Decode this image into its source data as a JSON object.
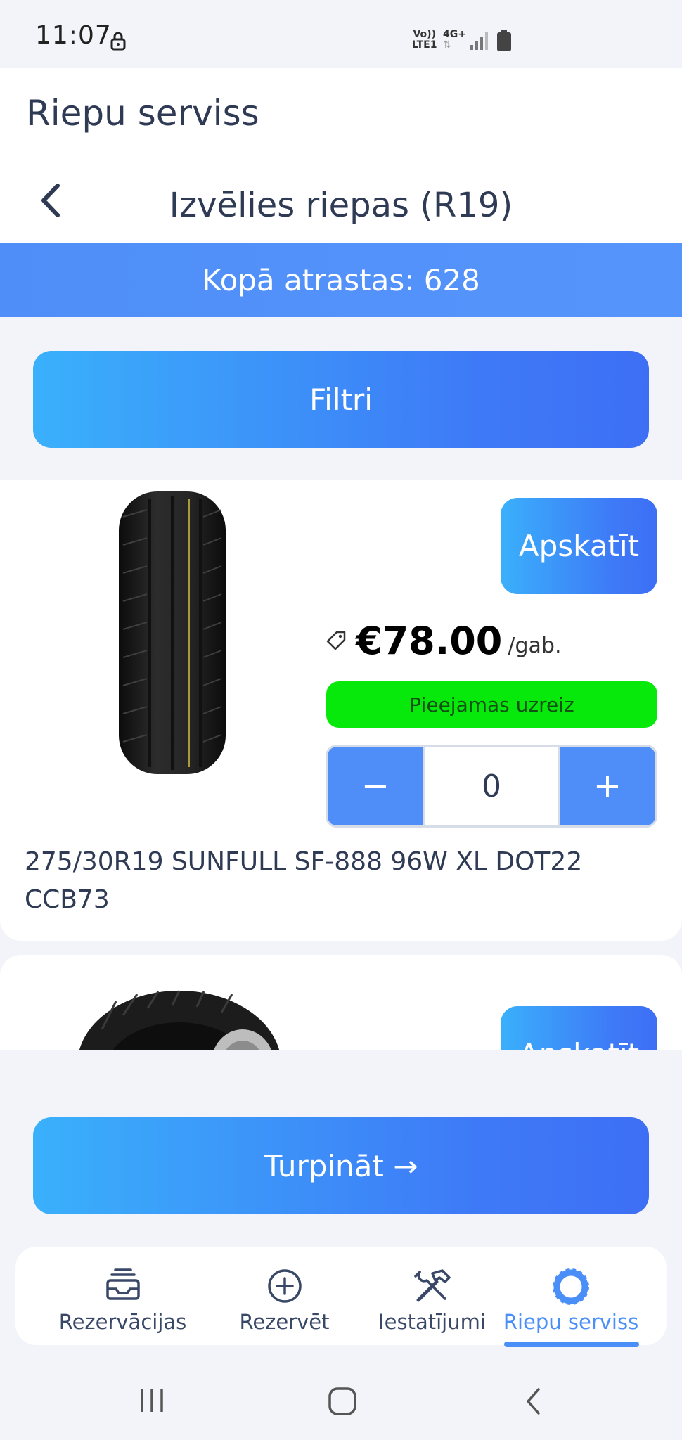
{
  "status_bar": {
    "time": "11:07",
    "network_top": "Vo))",
    "network_bottom": "LTE1",
    "network_type": "4G+"
  },
  "header": {
    "app_title": "Riepu serviss",
    "page_title": "Izvēlies riepas (R19)"
  },
  "results": {
    "count_label": "Kopā atrastas: 628"
  },
  "filters": {
    "label": "Filtri"
  },
  "products": [
    {
      "view_label": "Apskatīt",
      "price": "€78.00",
      "unit": "/gab.",
      "availability": "Pieejamas uzreiz",
      "availability_color": "#07e80b",
      "quantity": "0",
      "name": "275/30R19 SUNFULL SF-888 96W XL DOT22 CCB73"
    },
    {
      "view_label": "Apskatīt"
    }
  ],
  "stepper": {
    "minus": "−",
    "plus": "+"
  },
  "actions": {
    "continue_label": "Turpināt →"
  },
  "bottom_nav": {
    "items": [
      {
        "label": "Rezervācijas",
        "icon": "inbox-icon"
      },
      {
        "label": "Rezervēt",
        "icon": "plus-circle-icon"
      },
      {
        "label": "Iestatījumi",
        "icon": "tools-icon"
      },
      {
        "label": "Riepu serviss",
        "icon": "tire-icon",
        "active": true
      }
    ]
  },
  "colors": {
    "accent": "#4f8ef8",
    "gradient_start": "#3ab0fb",
    "gradient_end": "#3d6ff5",
    "text": "#2f3a55",
    "background": "#f3f4f9"
  }
}
